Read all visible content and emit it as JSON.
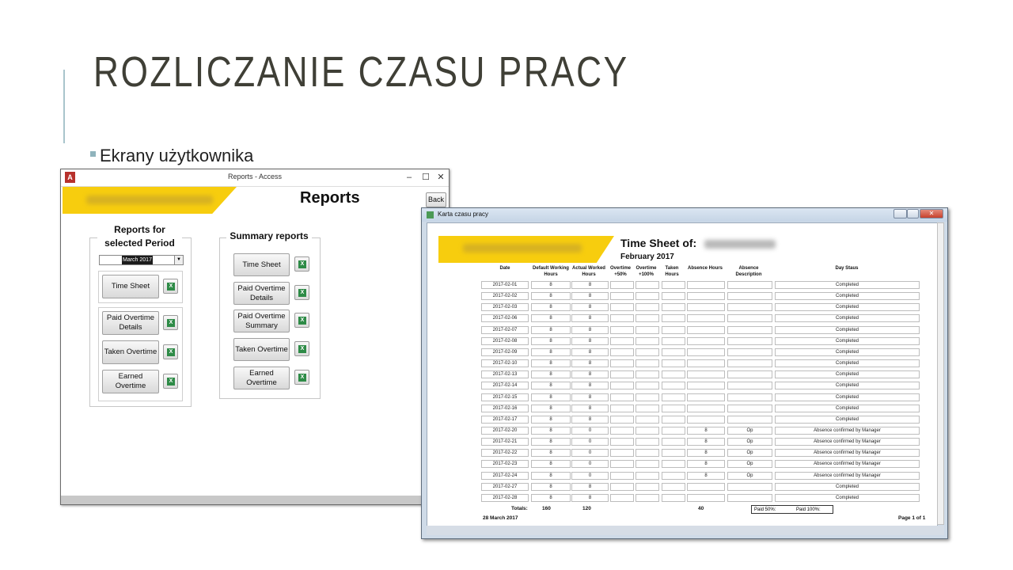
{
  "slide": {
    "title": "ROZLICZANIE CZASU PRACY",
    "bullet": "Ekrany użytkownika"
  },
  "access_window": {
    "title": "Reports - Access",
    "logo": "A",
    "icons": {
      "minimize": "minimize-icon",
      "maximize": "maximize-icon",
      "close": "close-icon"
    },
    "heading": "Reports",
    "back_label": "Back",
    "period_group": {
      "title_line1": "Reports for",
      "title_line2": "selected Period",
      "period_value": "March 2017",
      "buttons": [
        "Time Sheet",
        "Paid Overtime Details",
        "Taken Overtime",
        "Earned Overtime"
      ]
    },
    "summary_group": {
      "title": "Summary reports",
      "buttons": [
        "Time Sheet",
        "Paid Overtime Details",
        "Paid Overtime Summary",
        "Taken Overtime",
        "Earned Overtime"
      ]
    }
  },
  "timesheet_window": {
    "title": "Karta czasu pracy",
    "heading": "Time Sheet of:",
    "month": "February 2017",
    "columns": [
      "Date",
      "Default Working Hours",
      "Actual Worked Hours",
      "Overtime +50%",
      "Overtime +100%",
      "Taken Hours",
      "Absence Hours",
      "Absence Description",
      "Day Staus"
    ],
    "rows": [
      {
        "date": "2017-02-01",
        "default": "8",
        "actual": "8",
        "ot50": "",
        "ot100": "",
        "taken": "",
        "absence": "",
        "desc": "",
        "status": "Completed"
      },
      {
        "date": "2017-02-02",
        "default": "8",
        "actual": "8",
        "ot50": "",
        "ot100": "",
        "taken": "",
        "absence": "",
        "desc": "",
        "status": "Completed"
      },
      {
        "date": "2017-02-03",
        "default": "8",
        "actual": "8",
        "ot50": "",
        "ot100": "",
        "taken": "",
        "absence": "",
        "desc": "",
        "status": "Completed"
      },
      {
        "date": "2017-02-06",
        "default": "8",
        "actual": "8",
        "ot50": "",
        "ot100": "",
        "taken": "",
        "absence": "",
        "desc": "",
        "status": "Completed"
      },
      {
        "date": "2017-02-07",
        "default": "8",
        "actual": "8",
        "ot50": "",
        "ot100": "",
        "taken": "",
        "absence": "",
        "desc": "",
        "status": "Completed"
      },
      {
        "date": "2017-02-08",
        "default": "8",
        "actual": "8",
        "ot50": "",
        "ot100": "",
        "taken": "",
        "absence": "",
        "desc": "",
        "status": "Completed"
      },
      {
        "date": "2017-02-09",
        "default": "8",
        "actual": "8",
        "ot50": "",
        "ot100": "",
        "taken": "",
        "absence": "",
        "desc": "",
        "status": "Completed"
      },
      {
        "date": "2017-02-10",
        "default": "8",
        "actual": "8",
        "ot50": "",
        "ot100": "",
        "taken": "",
        "absence": "",
        "desc": "",
        "status": "Completed"
      },
      {
        "date": "2017-02-13",
        "default": "8",
        "actual": "8",
        "ot50": "",
        "ot100": "",
        "taken": "",
        "absence": "",
        "desc": "",
        "status": "Completed"
      },
      {
        "date": "2017-02-14",
        "default": "8",
        "actual": "8",
        "ot50": "",
        "ot100": "",
        "taken": "",
        "absence": "",
        "desc": "",
        "status": "Completed"
      },
      {
        "date": "2017-02-15",
        "default": "8",
        "actual": "8",
        "ot50": "",
        "ot100": "",
        "taken": "",
        "absence": "",
        "desc": "",
        "status": "Completed"
      },
      {
        "date": "2017-02-16",
        "default": "8",
        "actual": "8",
        "ot50": "",
        "ot100": "",
        "taken": "",
        "absence": "",
        "desc": "",
        "status": "Completed"
      },
      {
        "date": "2017-02-17",
        "default": "8",
        "actual": "8",
        "ot50": "",
        "ot100": "",
        "taken": "",
        "absence": "",
        "desc": "",
        "status": "Completed"
      },
      {
        "date": "2017-02-20",
        "default": "8",
        "actual": "0",
        "ot50": "",
        "ot100": "",
        "taken": "",
        "absence": "8",
        "desc": "Op",
        "status": "Absence confirmed by Manager"
      },
      {
        "date": "2017-02-21",
        "default": "8",
        "actual": "0",
        "ot50": "",
        "ot100": "",
        "taken": "",
        "absence": "8",
        "desc": "Op",
        "status": "Absence confirmed by Manager"
      },
      {
        "date": "2017-02-22",
        "default": "8",
        "actual": "0",
        "ot50": "",
        "ot100": "",
        "taken": "",
        "absence": "8",
        "desc": "Op",
        "status": "Absence confirmed by Manager"
      },
      {
        "date": "2017-02-23",
        "default": "8",
        "actual": "0",
        "ot50": "",
        "ot100": "",
        "taken": "",
        "absence": "8",
        "desc": "Op",
        "status": "Absence confirmed by Manager"
      },
      {
        "date": "2017-02-24",
        "default": "8",
        "actual": "0",
        "ot50": "",
        "ot100": "",
        "taken": "",
        "absence": "8",
        "desc": "Op",
        "status": "Absence confirmed by Manager"
      },
      {
        "date": "2017-02-27",
        "default": "8",
        "actual": "8",
        "ot50": "",
        "ot100": "",
        "taken": "",
        "absence": "",
        "desc": "",
        "status": "Completed"
      },
      {
        "date": "2017-02-28",
        "default": "8",
        "actual": "8",
        "ot50": "",
        "ot100": "",
        "taken": "",
        "absence": "",
        "desc": "",
        "status": "Completed"
      }
    ],
    "totals": {
      "label": "Totals:",
      "default": "160",
      "actual": "120",
      "absence": "40",
      "paid50": "Paid 50%:",
      "paid100": "Paid 100%:"
    },
    "footer": {
      "date": "28 March 2017",
      "page": "Page 1 of 1"
    }
  }
}
